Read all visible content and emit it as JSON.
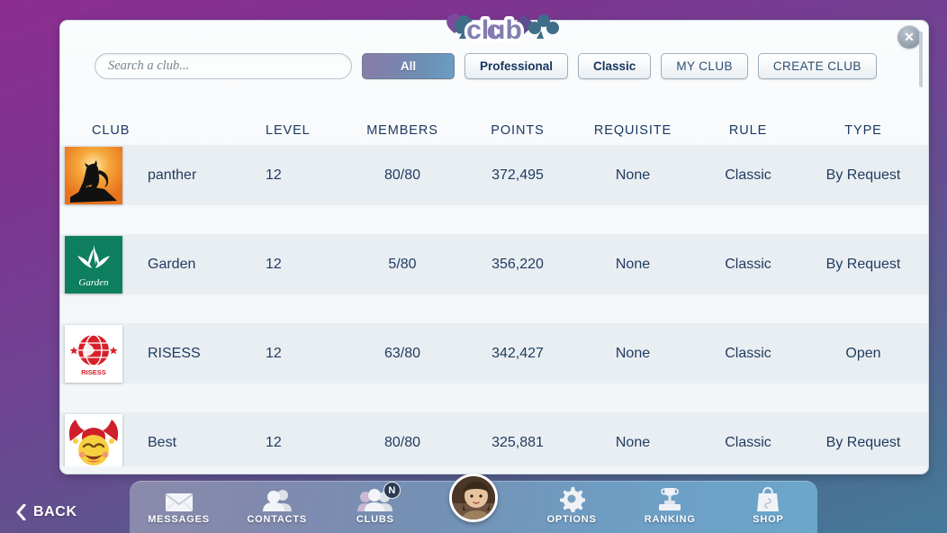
{
  "window": {
    "logo_text": "club",
    "close_label": "✕"
  },
  "toolbar": {
    "search_placeholder": "Search a club...",
    "search_value": "",
    "filters": [
      {
        "label": "All",
        "active": true
      },
      {
        "label": "Professional",
        "active": false
      },
      {
        "label": "Classic",
        "active": false
      }
    ],
    "my_club_label": "MY CLUB",
    "create_club_label": "CREATE CLUB"
  },
  "table": {
    "headers": [
      "CLUB",
      "LEVEL",
      "MEMBERS",
      "POINTS",
      "REQUISITE",
      "RULE",
      "TYPE"
    ],
    "rows": [
      {
        "name": "panther",
        "level": "12",
        "members": "80/80",
        "points": "372,495",
        "requisite": "None",
        "rule": "Classic",
        "type": "By Request",
        "avatar": "panther-sunset-avatar"
      },
      {
        "name": "Garden",
        "level": "12",
        "members": "5/80",
        "points": "356,220",
        "requisite": "None",
        "rule": "Classic",
        "type": "By Request",
        "avatar": "garden-green-leaf-avatar"
      },
      {
        "name": "RISESS",
        "level": "12",
        "members": "63/80",
        "points": "342,427",
        "requisite": "None",
        "rule": "Classic",
        "type": "Open",
        "avatar": "risess-red-globe-avatar"
      },
      {
        "name": "Best",
        "level": "12",
        "members": "80/80",
        "points": "325,881",
        "requisite": "None",
        "rule": "Classic",
        "type": "By Request",
        "avatar": "jester-face-avatar"
      }
    ]
  },
  "footer": {
    "back_label": "BACK",
    "nav": [
      {
        "label": "MESSAGES",
        "icon": "envelope-icon",
        "badge": ""
      },
      {
        "label": "CONTACTS",
        "icon": "contacts-icon",
        "badge": ""
      },
      {
        "label": "CLUBS",
        "icon": "clubs-icon",
        "badge": "N"
      },
      {
        "label": "OPTIONS",
        "icon": "gear-icon",
        "badge": ""
      },
      {
        "label": "RANKING",
        "icon": "trophy-icon",
        "badge": ""
      },
      {
        "label": "SHOP",
        "icon": "shopping-bag-icon",
        "badge": ""
      }
    ]
  },
  "colors": {
    "accent_purple": "#8c2e91",
    "accent_blue": "#447a9b",
    "text_navy": "#1f3a5f",
    "row_bg": "#e9eef2"
  }
}
